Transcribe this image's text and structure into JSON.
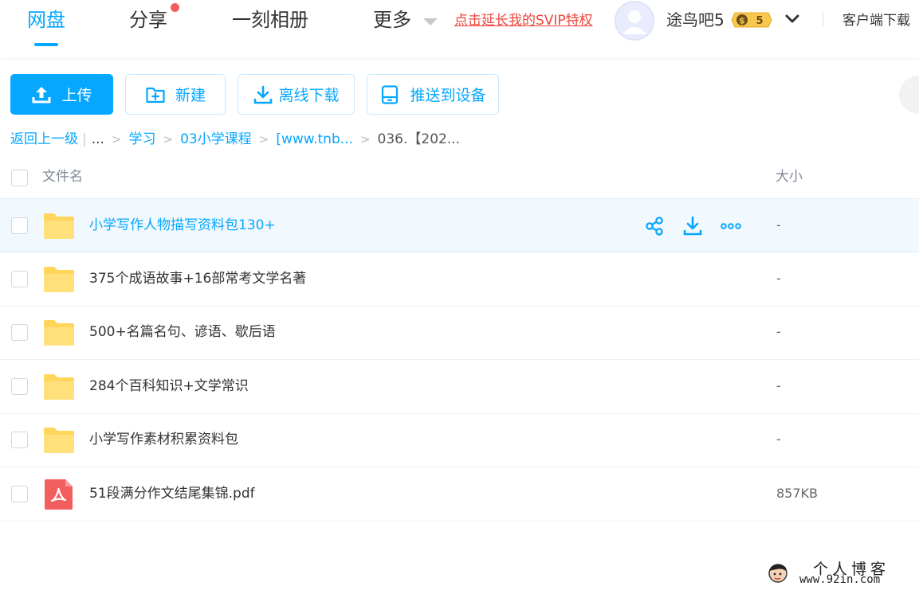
{
  "nav": {
    "tabs": [
      {
        "label": "网盘",
        "active": true
      },
      {
        "label": "分享",
        "has_dot": true
      },
      {
        "label": "一刻相册"
      },
      {
        "label": "更多"
      }
    ],
    "svip_promo": "点击延长我的SVIP特权",
    "username": "途鸟吧5",
    "vip_badge": "5",
    "client_download": "客户端下载"
  },
  "toolbar": {
    "upload": "上传",
    "new": "新建",
    "offline_download": "离线下载",
    "push_to_device": "推送到设备"
  },
  "breadcrumb": {
    "back": "返回上一级",
    "ellipsis": "...",
    "items": [
      "学习",
      "03小学课程",
      "[www.tnb..."
    ],
    "current": "036.【202..."
  },
  "list": {
    "col_name": "文件名",
    "col_size": "大小",
    "rows": [
      {
        "name": "小学写作人物描写资料包130+",
        "size": "-",
        "type": "folder",
        "hovered": true
      },
      {
        "name": "375个成语故事+16部常考文学名著",
        "size": "-",
        "type": "folder"
      },
      {
        "name": "500+名篇名句、谚语、歇后语",
        "size": "-",
        "type": "folder"
      },
      {
        "name": "284个百科知识+文学常识",
        "size": "-",
        "type": "folder"
      },
      {
        "name": "小学写作素材积累资料包",
        "size": "-",
        "type": "folder"
      },
      {
        "name": "51段满分作文结尾集锦.pdf",
        "size": "857KB",
        "type": "pdf"
      }
    ]
  },
  "watermark": {
    "title": "个人博客",
    "url": "www.92in.com"
  },
  "colors": {
    "accent": "#06a7ff",
    "promo_red": "#f0453a",
    "folder_yellow": "#ffd65c",
    "pdf_red": "#f25d5d"
  }
}
